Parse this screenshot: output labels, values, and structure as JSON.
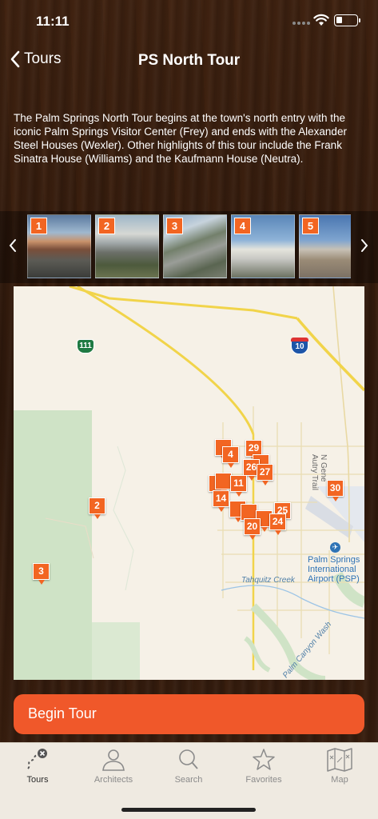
{
  "status_bar": {
    "time": "11:11"
  },
  "nav": {
    "back_label": "Tours",
    "title": "PS North Tour"
  },
  "description": "The Palm Springs North Tour begins at the town's north entry with the iconic Palm Springs Visitor Center (Frey) and ends with the Alexander Steel Houses (Wexler). Other highlights of this tour include the Frank Sinatra House (Williams) and the Kaufmann House (Neutra).",
  "thumbnails": [
    {
      "number": "1"
    },
    {
      "number": "2"
    },
    {
      "number": "3"
    },
    {
      "number": "4"
    },
    {
      "number": "5"
    }
  ],
  "map": {
    "route_shields": [
      "111",
      "10"
    ],
    "labels": {
      "street": "N Gene Autry Trail",
      "creek": "Tahquitz Creek",
      "wash": "Palm Canyon Wash",
      "airport_line1": "Palm Springs",
      "airport_line2": "International",
      "airport_line3": "Airport (PSP)"
    },
    "pins": [
      "2",
      "3",
      "4",
      "29",
      "26",
      "27",
      "11",
      "14",
      "30",
      "25",
      "24",
      "20"
    ]
  },
  "begin_button": {
    "label": "Begin Tour"
  },
  "tabs": [
    {
      "label": "Tours",
      "icon": "tours-route-icon",
      "active": true
    },
    {
      "label": "Architects",
      "icon": "person-icon",
      "active": false
    },
    {
      "label": "Search",
      "icon": "magnifier-icon",
      "active": false
    },
    {
      "label": "Favorites",
      "icon": "star-icon",
      "active": false
    },
    {
      "label": "Map",
      "icon": "folded-map-icon",
      "active": false
    }
  ],
  "colors": {
    "accent": "#f26522",
    "button": "#f0582a",
    "wood_dark": "#2c170b",
    "tabbar": "#efeae1"
  }
}
